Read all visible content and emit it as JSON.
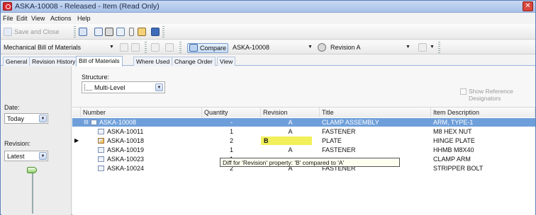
{
  "window": {
    "title": "ASKA-10008 - Released - Item (Read Only)"
  },
  "menu": [
    "File",
    "Edit",
    "View",
    "Actions",
    "Help"
  ],
  "toolbar1": {
    "save_close_label": "Save and Close"
  },
  "toolbar2": {
    "view_select": "Mechanical Bill of Materials",
    "compare_label": "Compare",
    "compare_item": "ASKA-10008",
    "revision_select": "Revision A"
  },
  "tabs": [
    "General",
    "Revision History",
    "Bill of Materials",
    "Where Used",
    "Change Order",
    "View"
  ],
  "left_panel": {
    "date_label": "Date:",
    "date_value": "Today",
    "revision_label": "Revision:",
    "revision_value": "Latest"
  },
  "structure": {
    "label": "Structure:",
    "value": "Multi-Level",
    "show_ref_des": "Show Reference Designators"
  },
  "grid": {
    "columns": [
      "Number",
      "Quantity",
      "Revision",
      "Title",
      "Item Description"
    ],
    "rows": [
      {
        "number": "ASKA-10008",
        "quantity": "-",
        "revision": "A",
        "title": "CLAMP ASSEMBLY",
        "description": "ARM, TYPE-1"
      },
      {
        "number": "ASKA-10011",
        "quantity": "1",
        "revision": "A",
        "title": "FASTENER",
        "description": "M8 HEX NUT"
      },
      {
        "number": "ASKA-10018",
        "quantity": "2",
        "revision": "B",
        "title": "PLATE",
        "description": "HINGE PLATE"
      },
      {
        "number": "ASKA-10019",
        "quantity": "1",
        "revision": "A",
        "title": "FASTENER",
        "description": "HHMB M8X40"
      },
      {
        "number": "ASKA-10023",
        "quantity": "1",
        "revision": "",
        "title": "",
        "description": "CLAMP ARM"
      },
      {
        "number": "ASKA-10024",
        "quantity": "2",
        "revision": "A",
        "title": "FASTENER",
        "description": "STRIPPER BOLT"
      }
    ]
  },
  "tooltip": "Diff for 'Revision' property: 'B' compared to 'A'",
  "colors": {
    "selection": "#6f9fda",
    "diff_highlight": "#f2f05a",
    "title_bar": "#b9cdee"
  }
}
